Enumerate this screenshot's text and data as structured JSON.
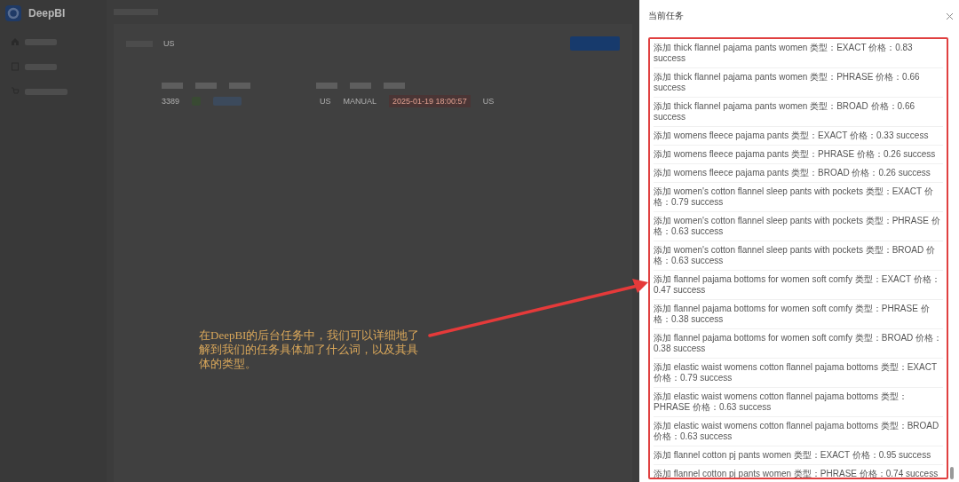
{
  "sidebar": {
    "logo": "DeepBI"
  },
  "filters": [
    {
      "value": "US"
    }
  ],
  "table": {
    "rows": [
      {
        "id": "3389",
        "country": "US",
        "operation": "MANUAL",
        "time": "2025-01-19 18:00:57",
        "country_2": "US"
      }
    ]
  },
  "drawer": {
    "title": "当前任务",
    "tasks": [
      "添加 thick flannel pajama pants women 类型：EXACT 价格：0.83 success",
      "添加 thick flannel pajama pants women 类型：PHRASE 价格：0.66 success",
      "添加 thick flannel pajama pants women 类型：BROAD 价格：0.66 success",
      "添加 womens fleece pajama pants 类型：EXACT 价格：0.33 success",
      "添加 womens fleece pajama pants 类型：PHRASE 价格：0.26 success",
      "添加 womens fleece pajama pants 类型：BROAD 价格：0.26 success",
      "添加 women's cotton flannel sleep pants with pockets 类型：EXACT 价格：0.79 success",
      "添加 women's cotton flannel sleep pants with pockets 类型：PHRASE 价格：0.63 success",
      "添加 women's cotton flannel sleep pants with pockets 类型：BROAD 价格：0.63 success",
      "添加 flannel pajama bottoms for women soft comfy 类型：EXACT 价格：0.47 success",
      "添加 flannel pajama bottoms for women soft comfy 类型：PHRASE 价格：0.38 success",
      "添加 flannel pajama bottoms for women soft comfy 类型：BROAD 价格：0.38 success",
      "添加 elastic waist womens cotton flannel pajama bottoms 类型：EXACT 价格：0.79 success",
      "添加 elastic waist womens cotton flannel pajama bottoms 类型：PHRASE 价格：0.63 success",
      "添加 elastic waist womens cotton flannel pajama bottoms 类型：BROAD 价格：0.63 success",
      "添加 flannel cotton pj pants women 类型：EXACT 价格：0.95 success",
      "添加 flannel cotton pj pants women 类型：PHRASE 价格：0.74 success"
    ]
  },
  "annotation": {
    "text": "在DeepBI的后台任务中，我们可以详细地了解到我们的任务具体加了什么词，以及其具体的类型。"
  }
}
